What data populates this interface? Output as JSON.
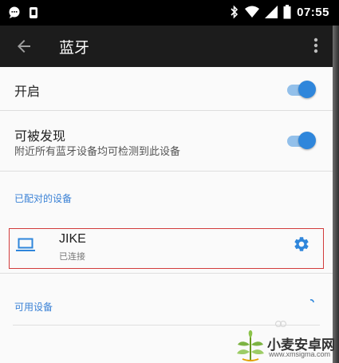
{
  "status_bar": {
    "time": "07:55",
    "left_icons": [
      "message-icon",
      "phone-notification-icon"
    ],
    "right_icons": [
      "bluetooth-icon",
      "wifi-icon",
      "signal-icon",
      "battery-icon"
    ]
  },
  "app_bar": {
    "title": "蓝牙",
    "back_icon": "arrow-left-icon",
    "menu_icon": "more-vert-icon"
  },
  "settings": {
    "enable": {
      "label": "开启",
      "on": true
    },
    "discoverable": {
      "label": "可被发现",
      "sub": "附近所有蓝牙设备均可检测到此设备",
      "on": true
    }
  },
  "paired": {
    "header": "已配对的设备",
    "devices": [
      {
        "name": "JIKE",
        "status": "已连接",
        "icon": "laptop-icon",
        "action_icon": "gear-icon"
      }
    ]
  },
  "available": {
    "header": "可用设备"
  },
  "watermark": {
    "text": "小麦安卓网",
    "url": "www.xmsigma.com"
  },
  "colors": {
    "accent": "#2f86db",
    "app_bar": "#1c1c1c",
    "highlight_border": "#d23c3c"
  }
}
